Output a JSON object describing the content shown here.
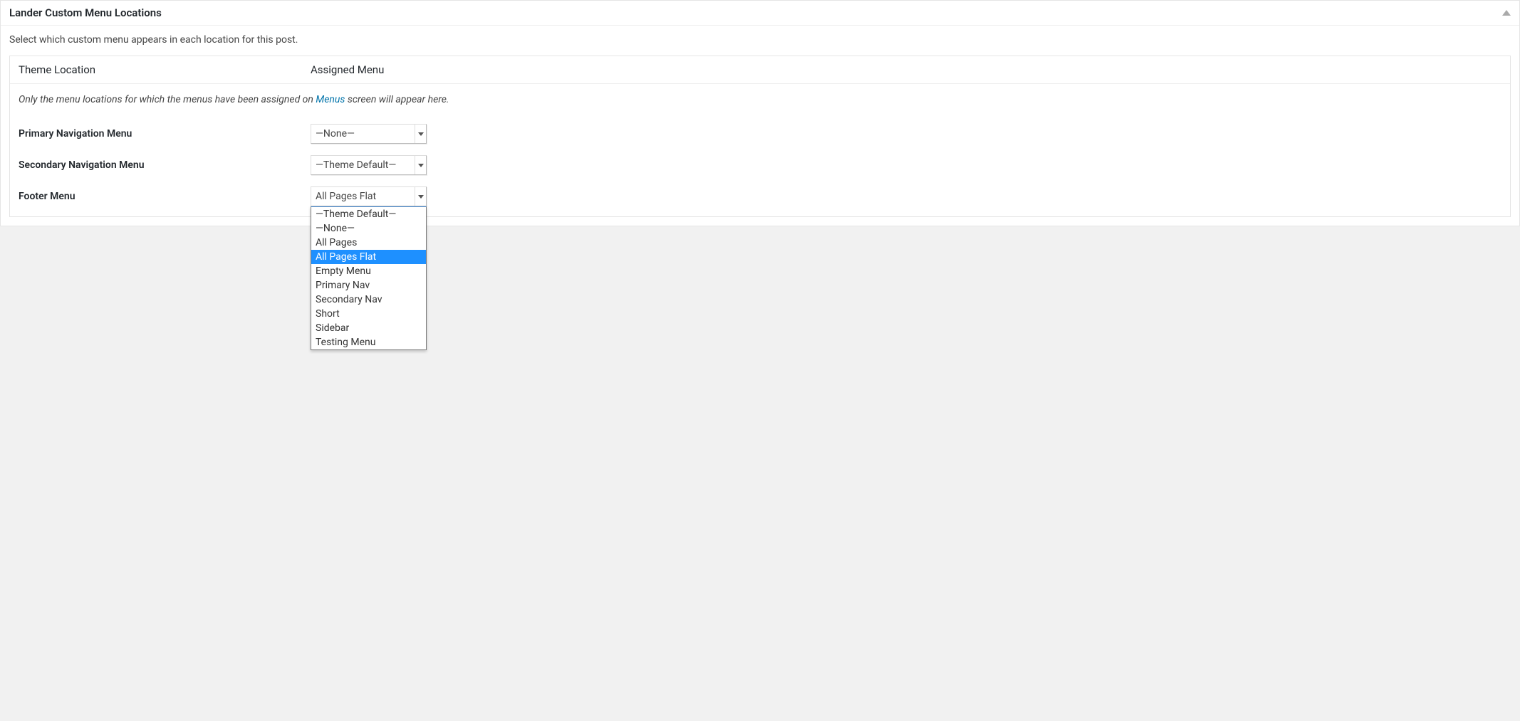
{
  "panel": {
    "title": "Lander Custom Menu Locations",
    "intro": "Select which custom menu appears in each location for this post.",
    "table_header": {
      "location": "Theme Location",
      "assigned": "Assigned Menu"
    },
    "note_pre": "Only the menu locations for which the menus have been assigned on ",
    "note_link": "Menus",
    "note_post": " screen will appear here."
  },
  "rows": [
    {
      "label": "Primary Navigation Menu",
      "selected": "—None—"
    },
    {
      "label": "Secondary Navigation Menu",
      "selected": "—Theme Default—"
    },
    {
      "label": "Footer Menu",
      "selected": "All Pages Flat"
    }
  ],
  "dropdown": {
    "options": [
      "—Theme Default—",
      "—None—",
      "All Pages",
      "All Pages Flat",
      "Empty Menu",
      "Primary Nav",
      "Secondary Nav",
      "Short",
      "Sidebar",
      "Testing Menu"
    ],
    "highlighted": "All Pages Flat"
  }
}
